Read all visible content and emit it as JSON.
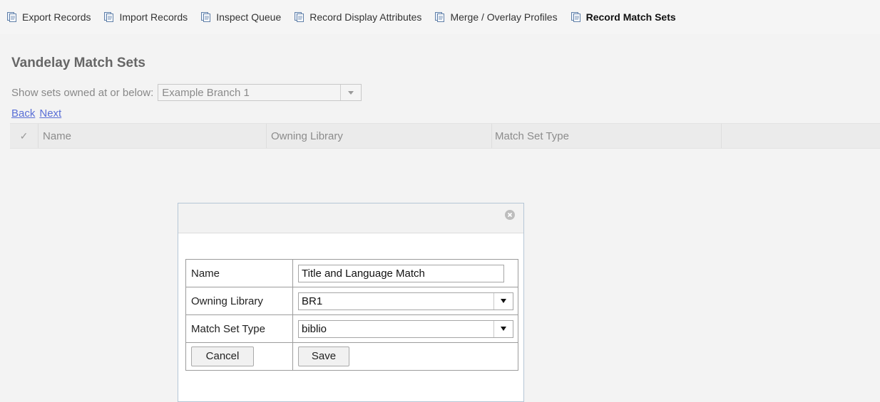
{
  "toolbar": {
    "items": [
      {
        "label": "Export Records",
        "icon": "document-icon"
      },
      {
        "label": "Import Records",
        "icon": "document-icon"
      },
      {
        "label": "Inspect Queue",
        "icon": "document-icon"
      },
      {
        "label": "Record Display Attributes",
        "icon": "document-icon"
      },
      {
        "label": "Merge / Overlay Profiles",
        "icon": "document-icon"
      },
      {
        "label": "Record Match Sets",
        "icon": "document-icon",
        "active": true
      }
    ]
  },
  "page": {
    "title": "Vandelay Match Sets",
    "owner_label": "Show sets owned at or below:",
    "owner_value": "Example Branch 1"
  },
  "nav": {
    "back": "Back",
    "next": "Next"
  },
  "grid": {
    "check_header": "✓",
    "columns": [
      "Name",
      "Owning Library",
      "Match Set Type"
    ]
  },
  "dialog": {
    "fields": {
      "name_label": "Name",
      "name_value": "Title and Language Match",
      "library_label": "Owning Library",
      "library_value": "BR1",
      "type_label": "Match Set Type",
      "type_value": "biblio"
    },
    "cancel_label": "Cancel",
    "save_label": "Save"
  },
  "colors": {
    "link": "#5a6fd6",
    "dialog_border": "#b5c6d6",
    "page_background": "#f3f3f3"
  }
}
